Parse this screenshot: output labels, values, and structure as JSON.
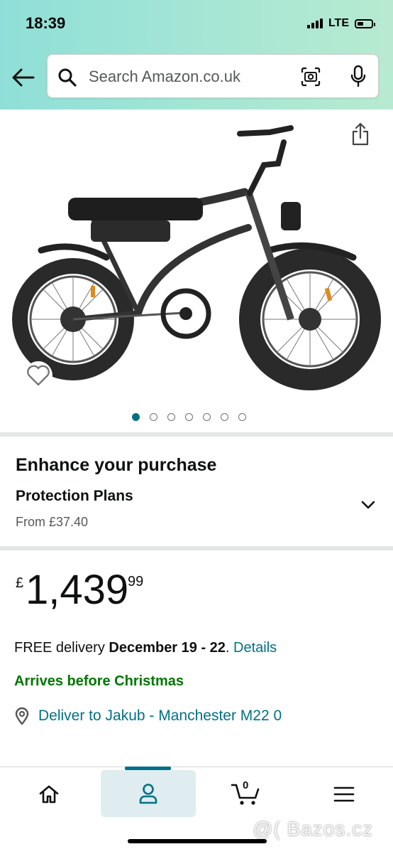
{
  "status_bar": {
    "time": "18:39",
    "network": "LTE"
  },
  "search": {
    "placeholder": "Search Amazon.co.uk"
  },
  "gallery": {
    "image_count": 7,
    "active_index": 0
  },
  "enhance": {
    "title": "Enhance your purchase",
    "plans_title": "Protection Plans",
    "plans_price": "From £37.40"
  },
  "price": {
    "symbol": "£",
    "whole": "1,439",
    "fraction": "99"
  },
  "delivery": {
    "prefix": "FREE delivery ",
    "dates": "December 19 - 22",
    "suffix": ". ",
    "details_link": "Details",
    "christmas": "Arrives before Christmas",
    "deliver_to": "Deliver to Jakub - Manchester M22 0"
  },
  "nav": {
    "cart_count": "0",
    "items": [
      "home-icon",
      "account-icon",
      "cart-icon",
      "menu-icon"
    ]
  },
  "watermark": "@( Bazos.cz",
  "colors": {
    "link": "#007185",
    "green": "#007600",
    "accent": "#007185"
  }
}
